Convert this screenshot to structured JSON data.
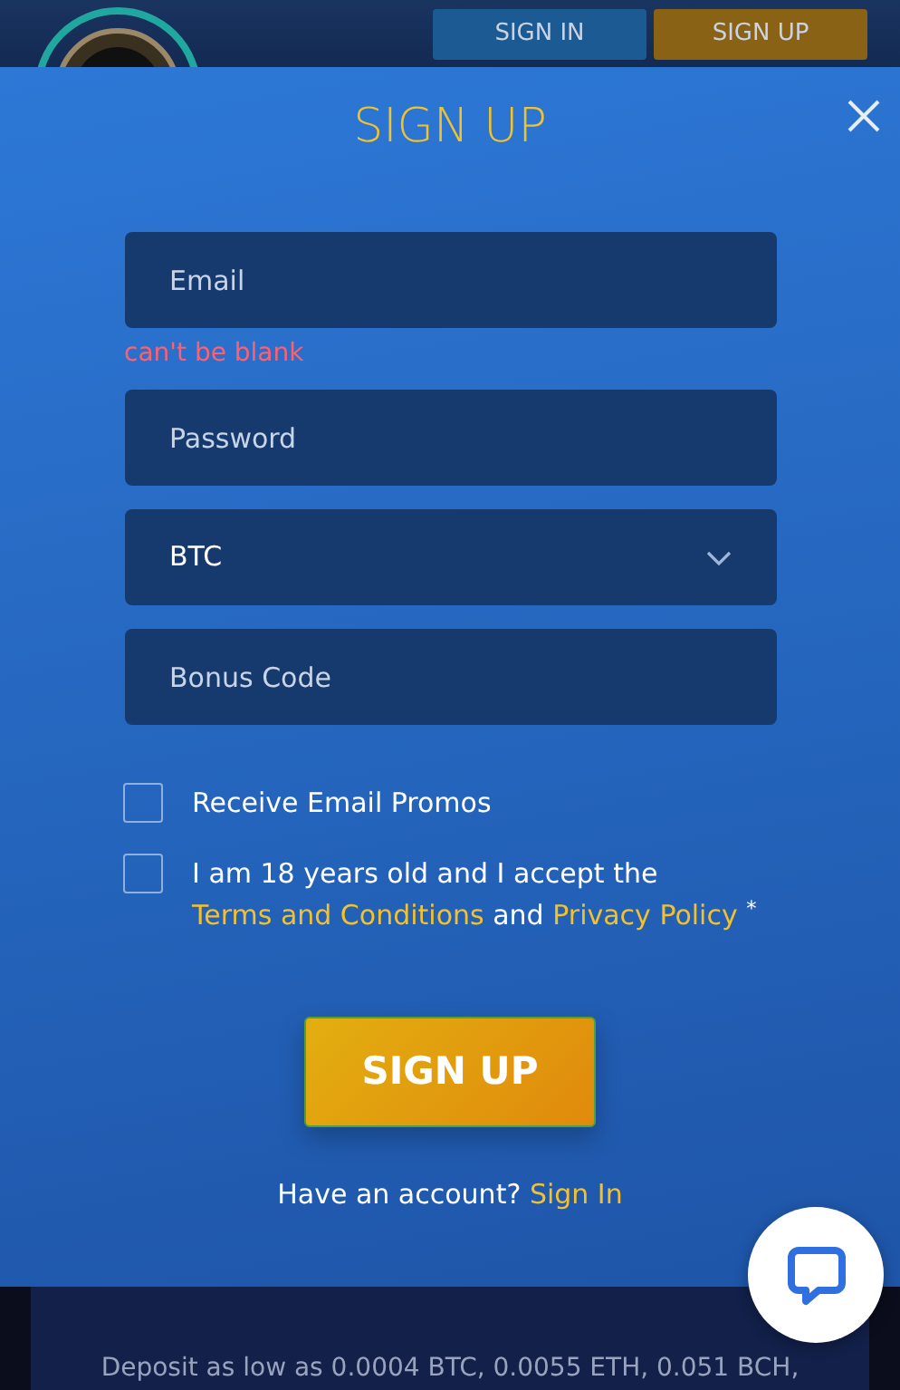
{
  "header": {
    "buttons": [
      {
        "label": "SIGN IN",
        "kind": "secondary"
      },
      {
        "label": "SIGN UP",
        "kind": "primary"
      }
    ]
  },
  "modal": {
    "title": "SIGN UP",
    "fields": [
      {
        "kind": "input",
        "placeholder": "Email",
        "error": "can't be blank"
      },
      {
        "kind": "password",
        "placeholder": "Password"
      },
      {
        "kind": "select",
        "value": "BTC"
      },
      {
        "kind": "input",
        "placeholder": "Bonus Code"
      }
    ],
    "checkboxes": [
      {
        "checked": false,
        "parts": [
          {
            "text": "Receive Email Promos",
            "kind": "text"
          }
        ]
      },
      {
        "checked": false,
        "required_mark": "*",
        "parts": [
          {
            "text": "I am 18 years old and I accept the",
            "kind": "text"
          },
          {
            "text": "Terms and Conditions",
            "kind": "link"
          },
          {
            "text": "and",
            "kind": "text"
          },
          {
            "text": "Privacy Policy",
            "kind": "link"
          }
        ]
      }
    ],
    "submit": "SIGN UP",
    "footer": {
      "text": "Have an account?",
      "link": "Sign In"
    }
  },
  "background_panel": {
    "text": "Deposit as low as 0.0004 BTC, 0.0055 ETH, 0.051 BCH,"
  }
}
